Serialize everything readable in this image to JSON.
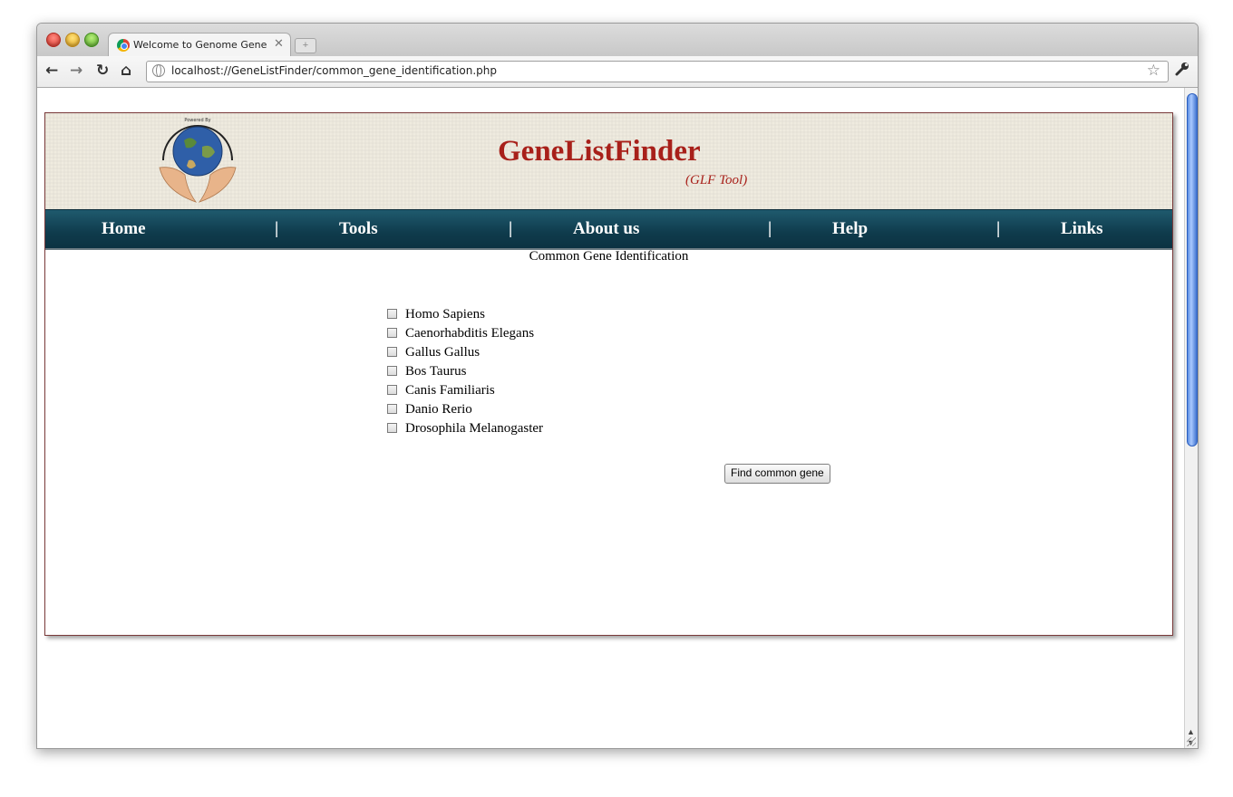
{
  "browser": {
    "tab_title": "Welcome to Genome Gene List Fi",
    "tab_close": "✕",
    "new_tab": "+",
    "url": "localhost://GeneListFinder/common_gene_identification.php",
    "back": "←",
    "forward": "→",
    "reload": "↻",
    "home": "⌂",
    "bookmark_star": "☆",
    "wrench": "🔧"
  },
  "site": {
    "logo_text": "Powered By",
    "title": "GeneListFinder",
    "subtitle": "(GLF Tool)",
    "title_color": "#a8201a",
    "menu_color": "#0f3b4c"
  },
  "menu": {
    "items": [
      "Home",
      "Tools",
      "About us",
      "Help",
      "Links"
    ],
    "separator": "|"
  },
  "main": {
    "section_title": "Common Gene Identification",
    "species": [
      "Homo Sapiens",
      "Caenorhabditis Elegans",
      "Gallus Gallus",
      "Bos Taurus",
      "Canis Familiaris",
      "Danio Rerio",
      "Drosophila Melanogaster"
    ],
    "submit_label": "Find common gene"
  }
}
